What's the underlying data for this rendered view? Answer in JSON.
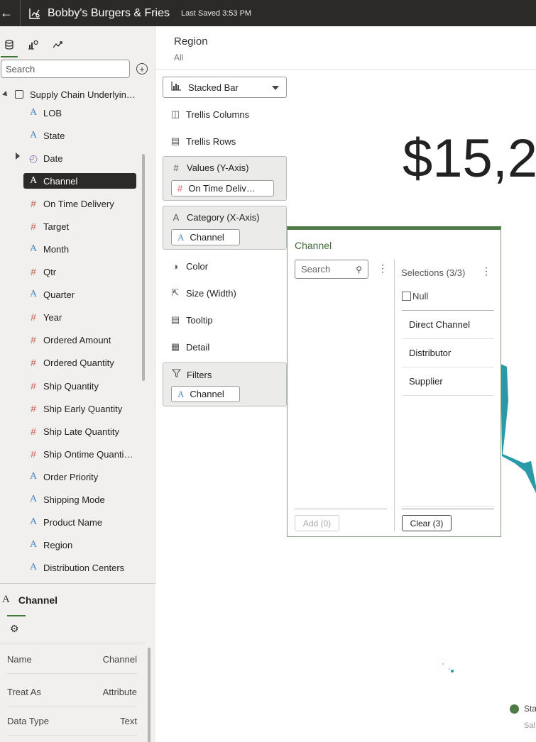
{
  "header": {
    "title": "Bobby's Burgers & Fries",
    "saved": "Last Saved 3:53 PM"
  },
  "left_panel": {
    "search_placeholder": "Search",
    "data_source": "Supply Chain Underlyin…",
    "fields": [
      {
        "label": "LOB",
        "type": "attribute"
      },
      {
        "label": "State",
        "type": "attribute"
      },
      {
        "label": "Date",
        "type": "date"
      },
      {
        "label": "Channel",
        "type": "attribute",
        "selected": true
      },
      {
        "label": "On Time Delivery",
        "type": "number"
      },
      {
        "label": "Target",
        "type": "number"
      },
      {
        "label": "Month",
        "type": "attribute"
      },
      {
        "label": "Qtr",
        "type": "number"
      },
      {
        "label": "Quarter",
        "type": "attribute"
      },
      {
        "label": "Year",
        "type": "number"
      },
      {
        "label": "Ordered Amount",
        "type": "number"
      },
      {
        "label": "Ordered Quantity",
        "type": "number"
      },
      {
        "label": "Ship Quantity",
        "type": "number"
      },
      {
        "label": "Ship Early Quantity",
        "type": "number"
      },
      {
        "label": "Ship Late Quantity",
        "type": "number"
      },
      {
        "label": "Ship Ontime Quanti…",
        "type": "number"
      },
      {
        "label": "Order Priority",
        "type": "attribute"
      },
      {
        "label": "Shipping Mode",
        "type": "attribute"
      },
      {
        "label": "Product Name",
        "type": "attribute"
      },
      {
        "label": "Region",
        "type": "attribute"
      },
      {
        "label": "Distribution Centers",
        "type": "attribute"
      }
    ]
  },
  "properties": {
    "title": "Channel",
    "rows": [
      {
        "key": "Name",
        "value": "Channel"
      },
      {
        "key": "Treat As",
        "value": "Attribute"
      },
      {
        "key": "Data Type",
        "value": "Text"
      }
    ]
  },
  "filter_bar": {
    "label": "Region",
    "value": "All"
  },
  "grammar": {
    "viz_type": "Stacked Bar",
    "trellis_columns": "Trellis Columns",
    "trellis_rows": "Trellis Rows",
    "values_label": "Values (Y-Axis)",
    "values_pill": "On Time Deliv…",
    "category_label": "Category (X-Axis)",
    "category_pill": "Channel",
    "color": "Color",
    "size": "Size (Width)",
    "tooltip": "Tooltip",
    "detail": "Detail",
    "filters_label": "Filters",
    "filters_pill": "Channel"
  },
  "canvas": {
    "big_value": "$15,2",
    "legend_label": "Sta",
    "legend_sub": "Sal"
  },
  "popup": {
    "title": "Channel",
    "search_placeholder": "Search",
    "selections_header": "Selections (3/3)",
    "null_label": "Null",
    "selections": [
      "Direct Channel",
      "Distributor",
      "Supplier"
    ],
    "add_button": "Add (0)",
    "clear_button": "Clear (3)"
  },
  "colors": {
    "topbar": "#2b2a28",
    "accent": "#4e7a45",
    "chart_teal": "#2b9aa8"
  }
}
